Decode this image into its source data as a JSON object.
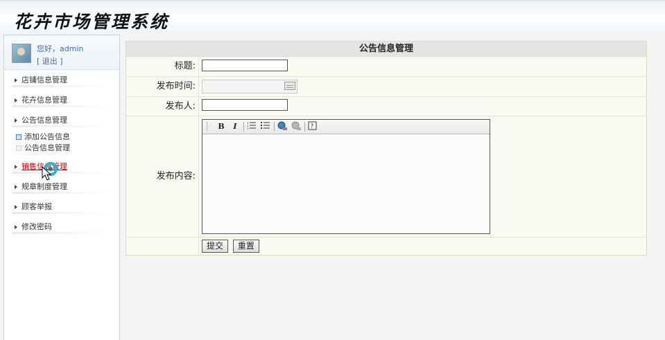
{
  "app": {
    "title": "花卉市场管理系统"
  },
  "user": {
    "greeting": "您好，admin",
    "logout": "[ 退出 ]"
  },
  "sidebar": {
    "items": [
      {
        "label": "店铺信息管理"
      },
      {
        "label": "花卉信息管理"
      },
      {
        "label": "公告信息管理",
        "expanded": true,
        "subitems": [
          {
            "label": "添加公告信息"
          },
          {
            "label": "公告信息管理"
          }
        ]
      },
      {
        "label": "销售信息管理",
        "hovered": true
      },
      {
        "label": "规章制度管理"
      },
      {
        "label": "顾客举报"
      },
      {
        "label": "修改密码"
      }
    ]
  },
  "form": {
    "title": "公告信息管理",
    "title_label": "标题:",
    "title_value": "",
    "time_label": "发布时间:",
    "time_value": "",
    "publisher_label": "发布人:",
    "publisher_value": "",
    "content_label": "发布内容:",
    "editor": {
      "bold": "B",
      "italic": "I",
      "toolbar_icons": [
        "bold-icon",
        "italic-icon",
        "ordered-list-icon",
        "unordered-list-icon",
        "globe-link-icon",
        "unlink-icon",
        "help-icon"
      ]
    },
    "submit_label": "提交",
    "reset_label": "重置"
  },
  "colors": {
    "link_blue": "#3a6eb5",
    "hover_red": "#d40000",
    "form_bg": "#fafaf2",
    "title_bar": "#e4e4e4",
    "cursor_ring": "#2ab4d6"
  }
}
